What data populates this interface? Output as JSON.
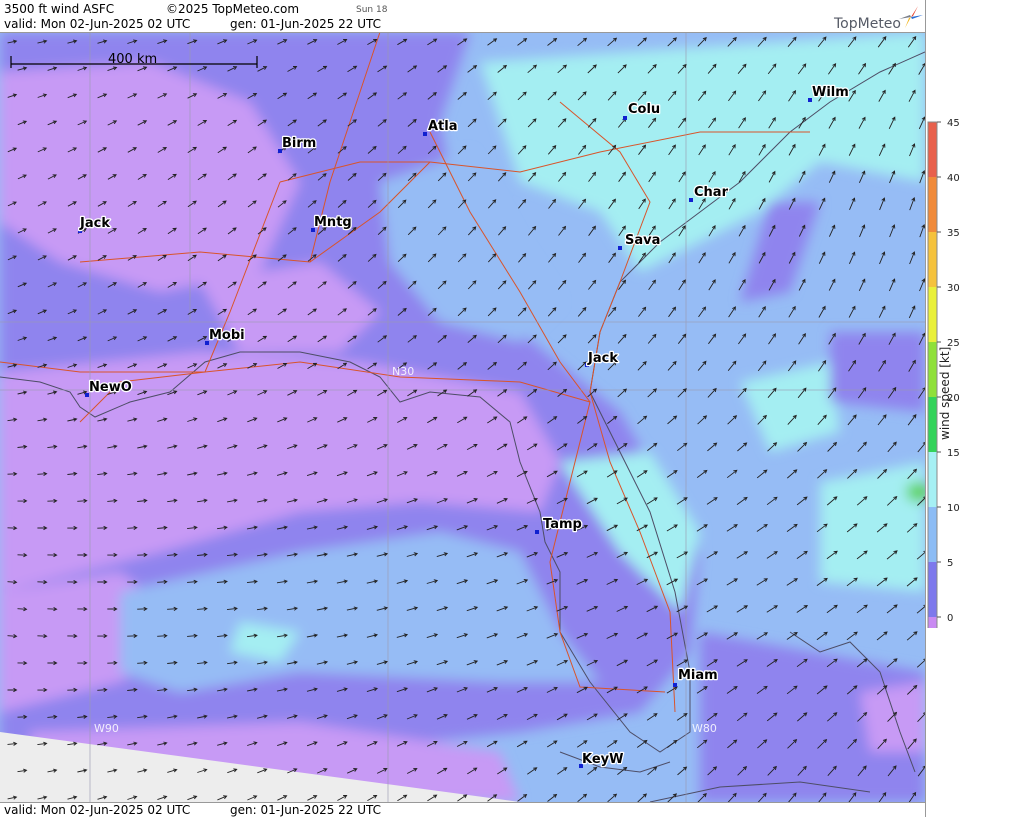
{
  "header": {
    "product": "3500 ft wind ASFC",
    "copyright": "©2025 TopMeteo.com",
    "run_tag": "Sun 18",
    "valid": "valid:  Mon  02-Jun-2025  02 UTC",
    "generated": "gen: 01-Jun-2025 22 UTC"
  },
  "footer": {
    "valid": "valid:  Mon  02-Jun-2025  02 UTC",
    "generated": "gen: 01-Jun-2025 22 UTC"
  },
  "brand": {
    "name": "TopMeteo",
    "star_colors": [
      "#e8402a",
      "#2a6fd6",
      "#f2b61f",
      "#7a7f8a"
    ]
  },
  "scale_bar": {
    "label": "400 km"
  },
  "grid_labels": {
    "lat_30": "N30",
    "lon_90": "W90",
    "lon_80": "W80"
  },
  "cities": [
    {
      "name": "Wilm"
    },
    {
      "name": "Colu"
    },
    {
      "name": "Atla"
    },
    {
      "name": "Birm"
    },
    {
      "name": "Char"
    },
    {
      "name": "Jack"
    },
    {
      "name": "Mntg"
    },
    {
      "name": "Sava"
    },
    {
      "name": "Jack"
    },
    {
      "name": "Mobi"
    },
    {
      "name": "NewO"
    },
    {
      "name": "Tamp"
    },
    {
      "name": "Miam"
    },
    {
      "name": "KeyW"
    }
  ],
  "legend": {
    "title": "wind speed [kt]",
    "ticks": [
      "45",
      "40",
      "35",
      "30",
      "25",
      "20",
      "15",
      "10",
      "5",
      "0"
    ],
    "colors": [
      "#e8604c",
      "#f08a3a",
      "#f5c23c",
      "#e9f03a",
      "#8fe03a",
      "#33d35a",
      "#a6f0f4",
      "#8cbcf5",
      "#7d78ec",
      "#c98af2"
    ]
  },
  "map_colors": {
    "calm": "#c79af5",
    "light": "#8f84ee",
    "moderate": "#96bcf5",
    "fresh": "#a4eef2",
    "strong": "#5fd45f",
    "outside": "#ededed"
  }
}
